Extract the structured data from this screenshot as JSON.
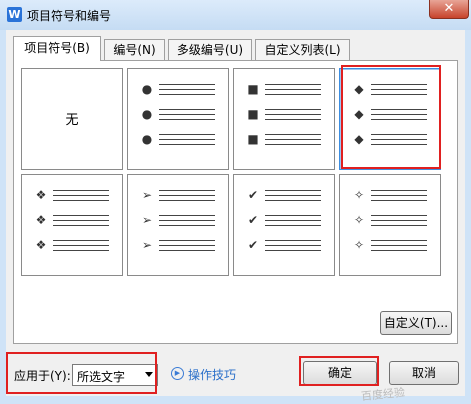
{
  "window": {
    "title": "项目符号和编号",
    "app_icon": "W",
    "close_glyph": "✕"
  },
  "tabs": [
    {
      "label": "项目符号(B)",
      "active": true
    },
    {
      "label": "编号(N)",
      "active": false
    },
    {
      "label": "多级编号(U)",
      "active": false
    },
    {
      "label": "自定义列表(L)",
      "active": false
    }
  ],
  "gallery": {
    "none_label": "无",
    "items": [
      {
        "bullet": "none",
        "glyph": ""
      },
      {
        "bullet": "filled-circle",
        "glyph": "●"
      },
      {
        "bullet": "filled-square",
        "glyph": "■"
      },
      {
        "bullet": "filled-diamond",
        "glyph": "◆",
        "selected": true
      },
      {
        "bullet": "four-diamonds",
        "glyph": "❖"
      },
      {
        "bullet": "arrowhead",
        "glyph": "➢"
      },
      {
        "bullet": "checkmark",
        "glyph": "✔"
      },
      {
        "bullet": "four-point-star",
        "glyph": "✧"
      }
    ]
  },
  "customize_button": "自定义(T)...",
  "apply_to": {
    "label": "应用于(Y):",
    "value": "所选文字"
  },
  "tips_link": "操作技巧",
  "ok_button": "确定",
  "cancel_button": "取消",
  "watermark": "百度经验"
}
